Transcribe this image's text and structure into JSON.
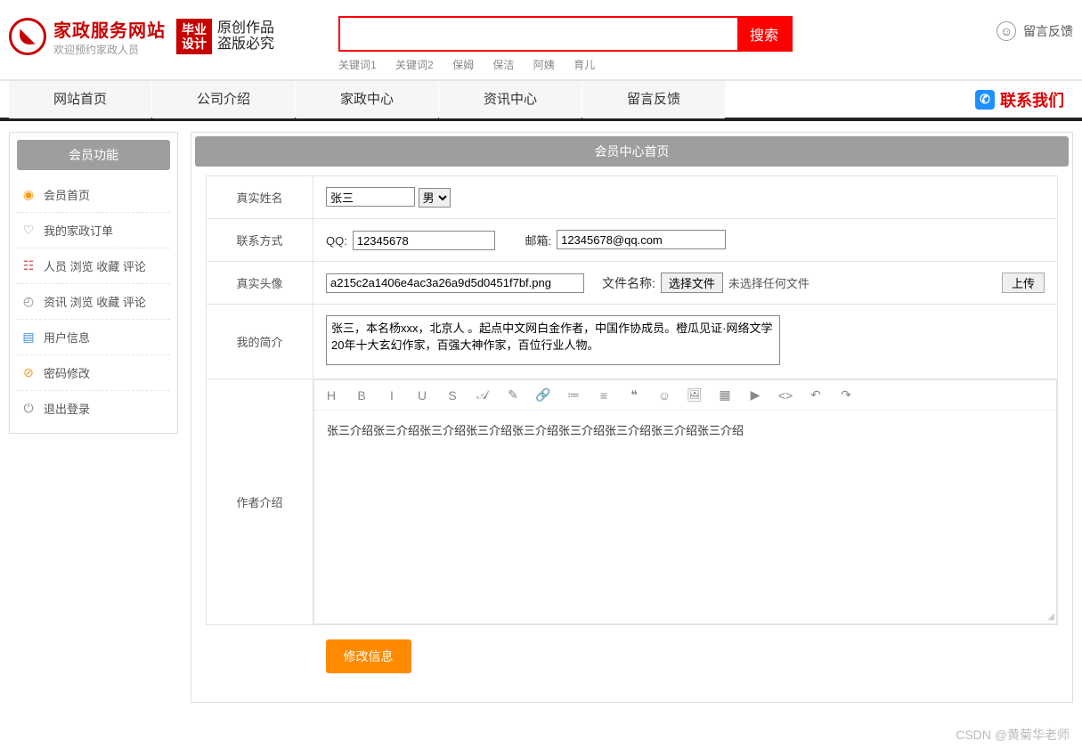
{
  "header": {
    "site_title": "家政服务网站",
    "site_subtitle": "欢迎预约家政人员",
    "badge": "毕业\n设计",
    "badge_side": "原创作品\n盗版必究",
    "search_button": "搜索",
    "keywords": [
      "关键词1",
      "关键词2",
      "保姆",
      "保洁",
      "阿姨",
      "育儿"
    ],
    "feedback": "留言反馈"
  },
  "nav": {
    "tabs": [
      "网站首页",
      "公司介绍",
      "家政中心",
      "资讯中心",
      "留言反馈"
    ],
    "contact": "联系我们"
  },
  "sidebar": {
    "title": "会员功能",
    "items": [
      {
        "icon": "home-icon",
        "color": "ic-orange",
        "glyph": "◉",
        "label": "会员首页"
      },
      {
        "icon": "order-icon",
        "color": "ic-gray",
        "glyph": "♡",
        "label": "我的家政订单"
      },
      {
        "icon": "people-icon",
        "color": "ic-red",
        "glyph": "☷",
        "label": "人员 浏览 收藏 评论"
      },
      {
        "icon": "news-icon",
        "color": "ic-gray",
        "glyph": "◴",
        "label": "资讯 浏览 收藏 评论"
      },
      {
        "icon": "user-icon",
        "color": "ic-blue",
        "glyph": "▤",
        "label": "用户信息"
      },
      {
        "icon": "password-icon",
        "color": "ic-orange",
        "glyph": "⊘",
        "label": "密码修改"
      },
      {
        "icon": "logout-icon",
        "color": "ic-gray",
        "glyph": "⏻",
        "label": "退出登录"
      }
    ]
  },
  "panel": {
    "title": "会员中心首页"
  },
  "form": {
    "labels": {
      "real_name": "真实姓名",
      "contact": "联系方式",
      "avatar": "真实头像",
      "bio": "我的简介",
      "author_intro": "作者介绍"
    },
    "real_name_value": "张三",
    "gender_selected": "男",
    "qq_label": "QQ:",
    "qq_value": "12345678",
    "email_label": "邮箱:",
    "email_value": "12345678@qq.com",
    "avatar_path": "a215c2a1406e4ac3a26a9d5d0451f7bf.png",
    "file_name_label": "文件名称:",
    "file_choose_btn": "选择文件",
    "file_status": "未选择任何文件",
    "upload_btn": "上传",
    "bio_text": "张三，本名杨xxx，北京人 。起点中文网白金作者，中国作协成员。橙瓜见证·网络文学20年十大玄幻作家，百强大神作家，百位行业人物。",
    "editor_toolbar": [
      "H",
      "B",
      "I",
      "U",
      "S",
      "𝒜",
      "✎",
      "🔗",
      "≔",
      "≡",
      "❝",
      "☺",
      "🖼",
      "▦",
      "▶",
      "<>",
      "↶",
      "↷"
    ],
    "editor_content": "张三介绍张三介绍张三介绍张三介绍张三介绍张三介绍张三介绍张三介绍张三介绍",
    "submit_btn": "修改信息"
  },
  "watermark": "CSDN @黄菊华老师"
}
